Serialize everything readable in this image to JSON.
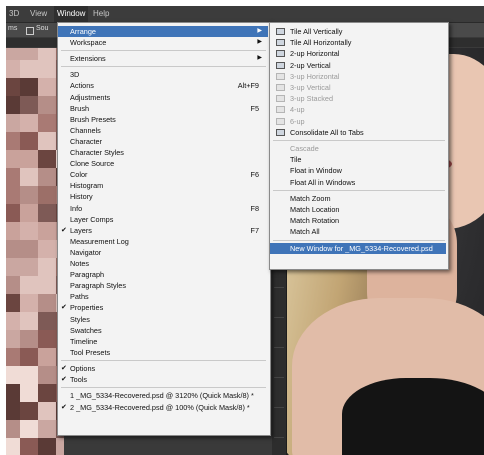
{
  "menubar": {
    "items": [
      "3D",
      "View",
      "Window",
      "Help"
    ]
  },
  "optionbar": {
    "items": [
      "ms",
      "Sou"
    ]
  },
  "window_menu": {
    "items": [
      {
        "label": "Arrange",
        "type": "submenu",
        "highlight": true
      },
      {
        "label": "Workspace",
        "type": "submenu"
      },
      {
        "type": "sep"
      },
      {
        "label": "Extensions",
        "type": "submenu"
      },
      {
        "type": "sep"
      },
      {
        "label": "3D"
      },
      {
        "label": "Actions",
        "shortcut": "Alt+F9"
      },
      {
        "label": "Adjustments"
      },
      {
        "label": "Brush",
        "shortcut": "F5"
      },
      {
        "label": "Brush Presets"
      },
      {
        "label": "Channels"
      },
      {
        "label": "Character"
      },
      {
        "label": "Character Styles"
      },
      {
        "label": "Clone Source"
      },
      {
        "label": "Color",
        "shortcut": "F6"
      },
      {
        "label": "Histogram"
      },
      {
        "label": "History"
      },
      {
        "label": "Info",
        "shortcut": "F8"
      },
      {
        "label": "Layer Comps"
      },
      {
        "label": "Layers",
        "shortcut": "F7",
        "checked": true
      },
      {
        "label": "Measurement Log"
      },
      {
        "label": "Navigator"
      },
      {
        "label": "Notes"
      },
      {
        "label": "Paragraph"
      },
      {
        "label": "Paragraph Styles"
      },
      {
        "label": "Paths"
      },
      {
        "label": "Properties",
        "checked": true
      },
      {
        "label": "Styles"
      },
      {
        "label": "Swatches"
      },
      {
        "label": "Timeline"
      },
      {
        "label": "Tool Presets"
      },
      {
        "type": "sep"
      },
      {
        "label": "Options",
        "checked": true
      },
      {
        "label": "Tools",
        "checked": true
      },
      {
        "type": "sep"
      },
      {
        "label": "1 _MG_5334-Recovered.psd @ 3120% (Quick Mask/8) *"
      },
      {
        "label": "2 _MG_5334-Recovered.psd @ 100% (Quick Mask/8) *",
        "checked": true
      }
    ]
  },
  "arrange_menu": {
    "items": [
      {
        "label": "Tile All Vertically"
      },
      {
        "label": "Tile All Horizontally"
      },
      {
        "label": "2-up Horizontal"
      },
      {
        "label": "2-up Vertical"
      },
      {
        "label": "3-up Horizontal",
        "disabled": true
      },
      {
        "label": "3-up Vertical",
        "disabled": true
      },
      {
        "label": "3-up Stacked",
        "disabled": true
      },
      {
        "label": "4-up",
        "disabled": true
      },
      {
        "label": "6-up",
        "disabled": true
      },
      {
        "label": "Consolidate All to Tabs"
      },
      {
        "type": "sep"
      },
      {
        "label": "Cascade",
        "disabled": true,
        "noicon": true
      },
      {
        "label": "Tile",
        "noicon": true
      },
      {
        "label": "Float in Window",
        "noicon": true
      },
      {
        "label": "Float All in Windows",
        "noicon": true
      },
      {
        "type": "sep"
      },
      {
        "label": "Match Zoom",
        "noicon": true
      },
      {
        "label": "Match Location",
        "noicon": true
      },
      {
        "label": "Match Rotation",
        "noicon": true
      },
      {
        "label": "Match All",
        "noicon": true
      },
      {
        "type": "sep"
      },
      {
        "label": "New Window for _MG_5334-Recovered.psd",
        "noicon": true,
        "highlight": true
      }
    ]
  },
  "colors": {
    "highlight": "#3f74b8",
    "menu_bg": "#f3f3f3",
    "chrome": "#3c3c3c"
  }
}
